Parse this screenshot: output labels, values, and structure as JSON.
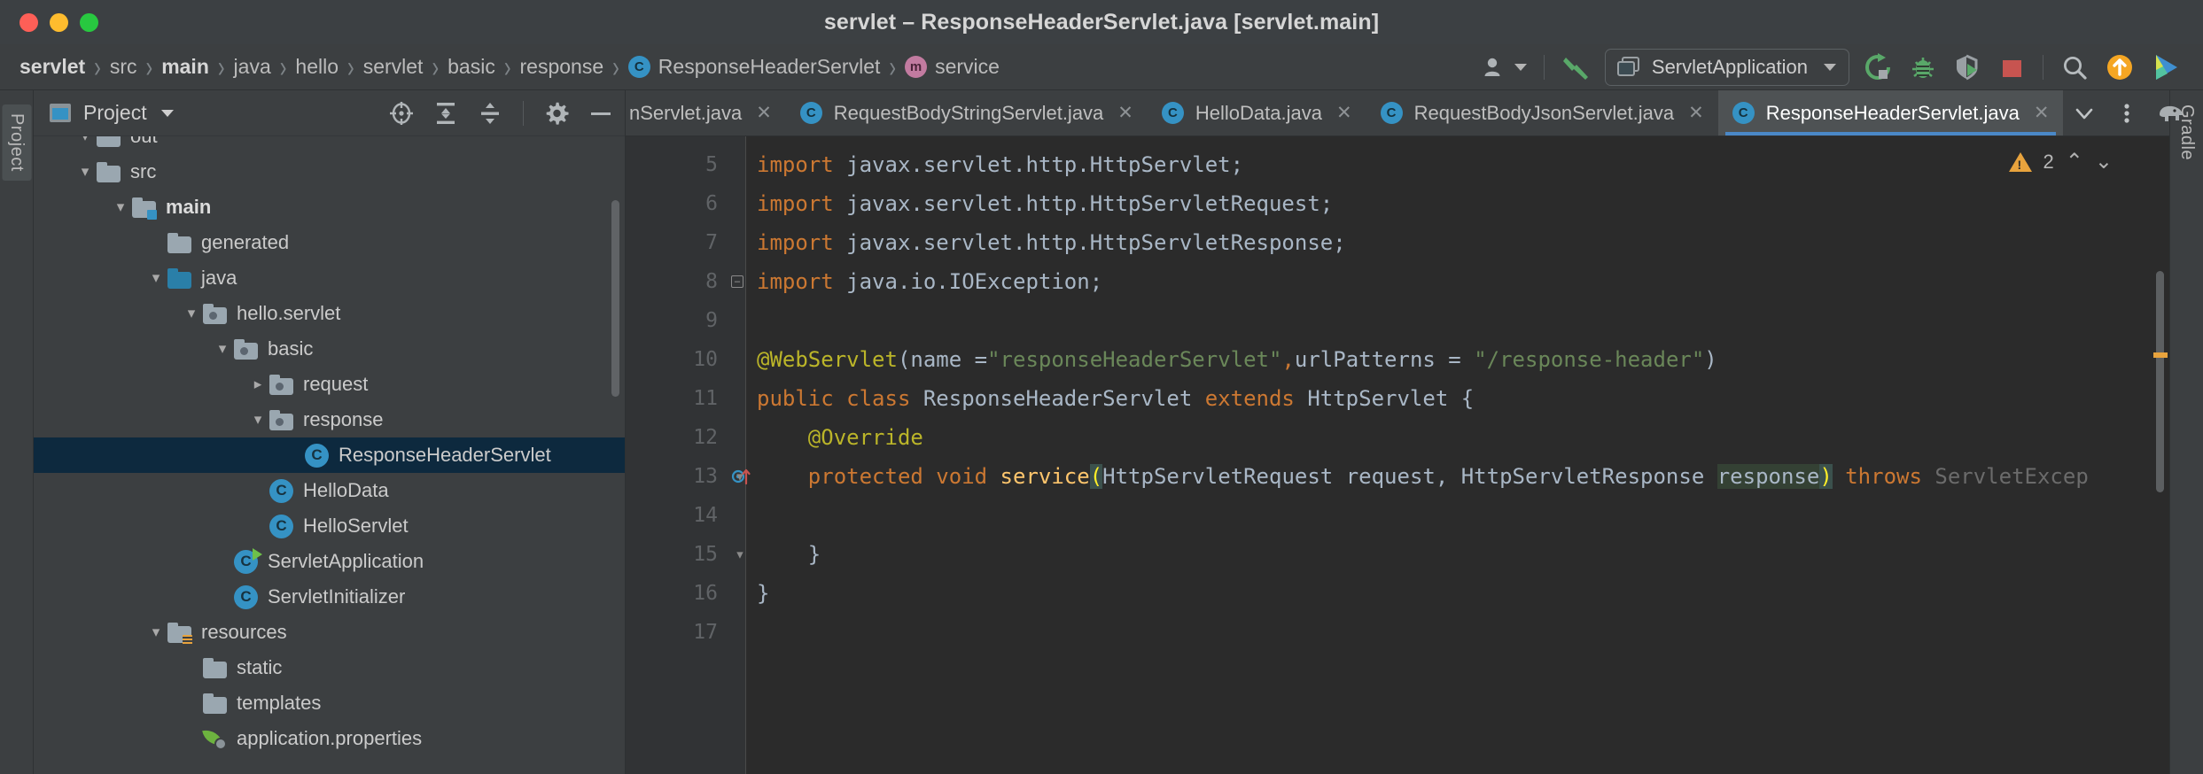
{
  "window": {
    "title": "servlet – ResponseHeaderServlet.java [servlet.main]",
    "traffic": [
      "close",
      "minimize",
      "maximize"
    ]
  },
  "breadcrumb": {
    "items": [
      {
        "label": "servlet",
        "bold": true,
        "icon": ""
      },
      {
        "label": "src",
        "bold": false,
        "icon": ""
      },
      {
        "label": "main",
        "bold": true,
        "icon": ""
      },
      {
        "label": "java",
        "bold": false,
        "icon": ""
      },
      {
        "label": "hello",
        "bold": false,
        "icon": ""
      },
      {
        "label": "servlet",
        "bold": false,
        "icon": ""
      },
      {
        "label": "basic",
        "bold": false,
        "icon": ""
      },
      {
        "label": "response",
        "bold": false,
        "icon": ""
      },
      {
        "label": "ResponseHeaderServlet",
        "bold": false,
        "icon": "class-icon",
        "badge": "C"
      },
      {
        "label": "service",
        "bold": false,
        "icon": "method-icon",
        "badge": "m"
      }
    ],
    "separator": "›"
  },
  "toolbar": {
    "account_icon": "user-account-icon",
    "build_icon": "build-hammer-icon",
    "run_config": {
      "label": "ServletApplication",
      "icon": "run-configuration-icon",
      "caret": "chevron-down-icon"
    },
    "buttons": [
      {
        "name": "run-button",
        "icon": "run-icon"
      },
      {
        "name": "debug-button",
        "icon": "debug-bug-icon"
      },
      {
        "name": "coverage-button",
        "icon": "run-with-coverage-icon"
      },
      {
        "name": "stop-button",
        "icon": "stop-square-icon"
      },
      {
        "name": "search-button",
        "icon": "search-magnifier-icon"
      },
      {
        "name": "update-button",
        "icon": "update-arrow-icon"
      },
      {
        "name": "ide-feature-button",
        "icon": "ide-logo-icon"
      }
    ],
    "colors": {
      "run_green": "#59a869",
      "stop_red": "#c75450",
      "update_orange": "#f5a623",
      "accent_blue": "#3592c4"
    }
  },
  "stripes": {
    "left_label": "Project",
    "right_label": "Gradle"
  },
  "project_panel": {
    "title": "Project",
    "caret": "chevron-down-icon",
    "tools": [
      {
        "name": "select-opened-file-icon",
        "icon": "target-crosshair-icon"
      },
      {
        "name": "expand-all-icon",
        "icon": "expand-all-icon"
      },
      {
        "name": "collapse-all-icon",
        "icon": "collapse-all-icon"
      },
      {
        "name": "settings-icon",
        "icon": "gear-icon"
      },
      {
        "name": "hide-panel-icon",
        "icon": "minus-icon"
      }
    ],
    "tree": [
      {
        "label": "out",
        "indent": 1,
        "arrow": "down",
        "icon": "folder",
        "bold": false,
        "selected": false,
        "partial": true
      },
      {
        "label": "src",
        "indent": 1,
        "arrow": "down",
        "icon": "folder",
        "bold": false,
        "selected": false
      },
      {
        "label": "main",
        "indent": 2,
        "arrow": "down",
        "icon": "folder-module",
        "bold": true,
        "selected": false
      },
      {
        "label": "generated",
        "indent": 3,
        "arrow": "none",
        "icon": "folder",
        "bold": false,
        "selected": false
      },
      {
        "label": "java",
        "indent": 3,
        "arrow": "down",
        "icon": "folder-source",
        "bold": false,
        "selected": false
      },
      {
        "label": "hello.servlet",
        "indent": 4,
        "arrow": "down",
        "icon": "package",
        "bold": false,
        "selected": false
      },
      {
        "label": "basic",
        "indent": 5,
        "arrow": "down",
        "icon": "package",
        "bold": false,
        "selected": false
      },
      {
        "label": "request",
        "indent": 6,
        "arrow": "right",
        "icon": "package",
        "bold": false,
        "selected": false
      },
      {
        "label": "response",
        "indent": 6,
        "arrow": "down",
        "icon": "package",
        "bold": false,
        "selected": false
      },
      {
        "label": "ResponseHeaderServlet",
        "indent": 7,
        "arrow": "none",
        "icon": "class",
        "bold": false,
        "selected": true
      },
      {
        "label": "HelloData",
        "indent": 6,
        "arrow": "none",
        "icon": "class",
        "bold": false,
        "selected": false
      },
      {
        "label": "HelloServlet",
        "indent": 6,
        "arrow": "none",
        "icon": "class",
        "bold": false,
        "selected": false
      },
      {
        "label": "ServletApplication",
        "indent": 5,
        "arrow": "none",
        "icon": "class-runnable",
        "bold": false,
        "selected": false
      },
      {
        "label": "ServletInitializer",
        "indent": 5,
        "arrow": "none",
        "icon": "class",
        "bold": false,
        "selected": false
      },
      {
        "label": "resources",
        "indent": 3,
        "arrow": "down",
        "icon": "folder-resource",
        "bold": false,
        "selected": false
      },
      {
        "label": "static",
        "indent": 4,
        "arrow": "none",
        "icon": "folder",
        "bold": false,
        "selected": false
      },
      {
        "label": "templates",
        "indent": 4,
        "arrow": "none",
        "icon": "folder",
        "bold": false,
        "selected": false
      },
      {
        "label": "application.properties",
        "indent": 4,
        "arrow": "none",
        "icon": "spring-leaf",
        "bold": false,
        "selected": false
      }
    ]
  },
  "editor": {
    "tabs": [
      {
        "label": "nServlet.java",
        "icon": "class-icon",
        "active": false,
        "clipped": true
      },
      {
        "label": "RequestBodyStringServlet.java",
        "icon": "class-icon",
        "active": false
      },
      {
        "label": "HelloData.java",
        "icon": "class-icon",
        "active": false
      },
      {
        "label": "RequestBodyJsonServlet.java",
        "icon": "class-icon",
        "active": false
      },
      {
        "label": "ResponseHeaderServlet.java",
        "icon": "class-icon",
        "active": true
      }
    ],
    "tab_close_glyph": "✕",
    "tab_actions": [
      {
        "name": "show-tab-list-button",
        "icon": "chevron-down-icon"
      },
      {
        "name": "tab-options-button",
        "icon": "vertical-dots-icon"
      },
      {
        "name": "gradle-elephant-icon",
        "icon": "gradle-elephant-icon"
      }
    ],
    "inspection": {
      "warning_icon": "warning-triangle-icon",
      "warning_count": "2",
      "prev_glyph": "⌃",
      "next_glyph": "⌄"
    },
    "lines": [
      {
        "num": "5",
        "fold": "none",
        "segments": [
          {
            "t": "import ",
            "c": "kw"
          },
          {
            "t": "javax.servlet.http.HttpServlet;",
            "c": "typ"
          }
        ]
      },
      {
        "num": "6",
        "fold": "none",
        "segments": [
          {
            "t": "import ",
            "c": "kw"
          },
          {
            "t": "javax.servlet.http.HttpServletRequest;",
            "c": "typ"
          }
        ]
      },
      {
        "num": "7",
        "fold": "none",
        "segments": [
          {
            "t": "import ",
            "c": "kw"
          },
          {
            "t": "javax.servlet.http.HttpServletResponse;",
            "c": "typ"
          }
        ]
      },
      {
        "num": "8",
        "fold": "minus",
        "segments": [
          {
            "t": "import ",
            "c": "kw"
          },
          {
            "t": "java.io.IOException;",
            "c": "typ"
          }
        ]
      },
      {
        "num": "9",
        "fold": "none",
        "segments": []
      },
      {
        "num": "10",
        "fold": "none",
        "segments": [
          {
            "t": "@WebServlet",
            "c": "ann"
          },
          {
            "t": "(",
            "c": "typ"
          },
          {
            "t": "name =",
            "c": "typ"
          },
          {
            "t": "\"responseHeaderServlet\"",
            "c": "str"
          },
          {
            "t": ",",
            "c": "kw"
          },
          {
            "t": "urlPatterns = ",
            "c": "typ"
          },
          {
            "t": "\"/response-header\"",
            "c": "str"
          },
          {
            "t": ")",
            "c": "typ"
          }
        ]
      },
      {
        "num": "11",
        "fold": "none",
        "segments": [
          {
            "t": "public class ",
            "c": "kw"
          },
          {
            "t": "ResponseHeaderServlet ",
            "c": "typ"
          },
          {
            "t": "extends ",
            "c": "kw"
          },
          {
            "t": "HttpServlet {",
            "c": "typ"
          }
        ]
      },
      {
        "num": "12",
        "fold": "none",
        "segments": [
          {
            "t": "    @Override",
            "c": "ann"
          }
        ]
      },
      {
        "num": "13",
        "fold": "method",
        "override": true,
        "segments": [
          {
            "t": "    ",
            "c": "typ"
          },
          {
            "t": "protected void ",
            "c": "kw"
          },
          {
            "t": "service",
            "c": "mth"
          },
          {
            "t": "(",
            "c": "paren-hl"
          },
          {
            "t": "HttpServletRequest request, HttpServletResponse ",
            "c": "typ"
          },
          {
            "t": "response",
            "c": "hl-resp"
          },
          {
            "t": ")",
            "c": "paren-hl"
          },
          {
            "t": " ",
            "c": "typ"
          },
          {
            "t": "throws ",
            "c": "kw"
          },
          {
            "t": "ServletExcep",
            "c": "dim"
          }
        ]
      },
      {
        "num": "14",
        "fold": "none",
        "segments": []
      },
      {
        "num": "15",
        "fold": "brace",
        "segments": [
          {
            "t": "    }",
            "c": "typ"
          }
        ]
      },
      {
        "num": "16",
        "fold": "none",
        "segments": [
          {
            "t": "}",
            "c": "typ"
          }
        ]
      },
      {
        "num": "17",
        "fold": "none",
        "segments": []
      }
    ]
  }
}
